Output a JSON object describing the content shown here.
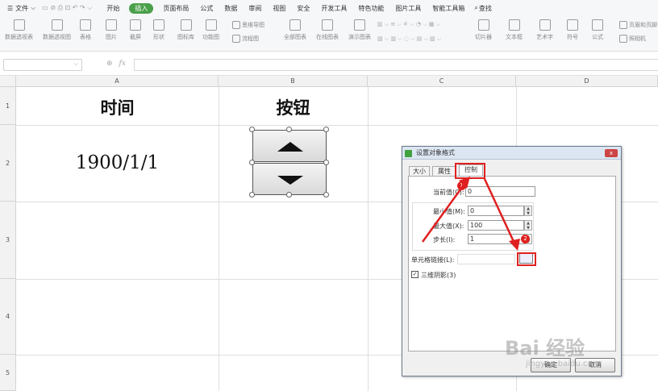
{
  "menubar": {
    "file_label": "文件",
    "tabs": [
      "开始",
      "插入",
      "页面布局",
      "公式",
      "数据",
      "审阅",
      "视图",
      "安全",
      "开发工具",
      "特色功能",
      "图片工具",
      "智能工具箱"
    ],
    "search_label": "查找"
  },
  "ribbon": {
    "items": [
      "数据透视表",
      "数据透视图",
      "表格",
      "图片",
      "截屏",
      "形状",
      "图标库",
      "功能图",
      "思维导图",
      "流程图",
      "全部图表",
      "在线图表",
      "演示图表",
      "切片器",
      "文本框",
      "艺术字",
      "符号",
      "公式",
      "页眉和页脚",
      "照相机"
    ]
  },
  "formula": {
    "fx_label": "fx"
  },
  "sheet": {
    "columns": [
      "A",
      "B",
      "C",
      "D"
    ],
    "rows": [
      "1",
      "2",
      "3",
      "4",
      "5"
    ],
    "a1": "时间",
    "b1": "按钮",
    "a2": "1900/1/1"
  },
  "dialog": {
    "title": "设置对象格式",
    "close": "x",
    "tabs": [
      "大小",
      "属性",
      "控制"
    ],
    "current_value_label": "当前值(C):",
    "current_value": "0",
    "min_label": "最小值(M):",
    "min_value": "0",
    "max_label": "最大值(X):",
    "max_value": "100",
    "step_label": "步长(I):",
    "step_value": "1",
    "cell_link_label": "单元格链接(L):",
    "shadow_label": "三维阴影(3)",
    "ok_label": "确定",
    "cancel_label": "取消",
    "badge1": "1",
    "badge2": "2"
  },
  "watermark": {
    "main": "Bai 经验",
    "sub": "jingyan.baidu.com"
  },
  "colors": {
    "accent_green": "#4aa04a",
    "annotation_red": "#e02020"
  }
}
